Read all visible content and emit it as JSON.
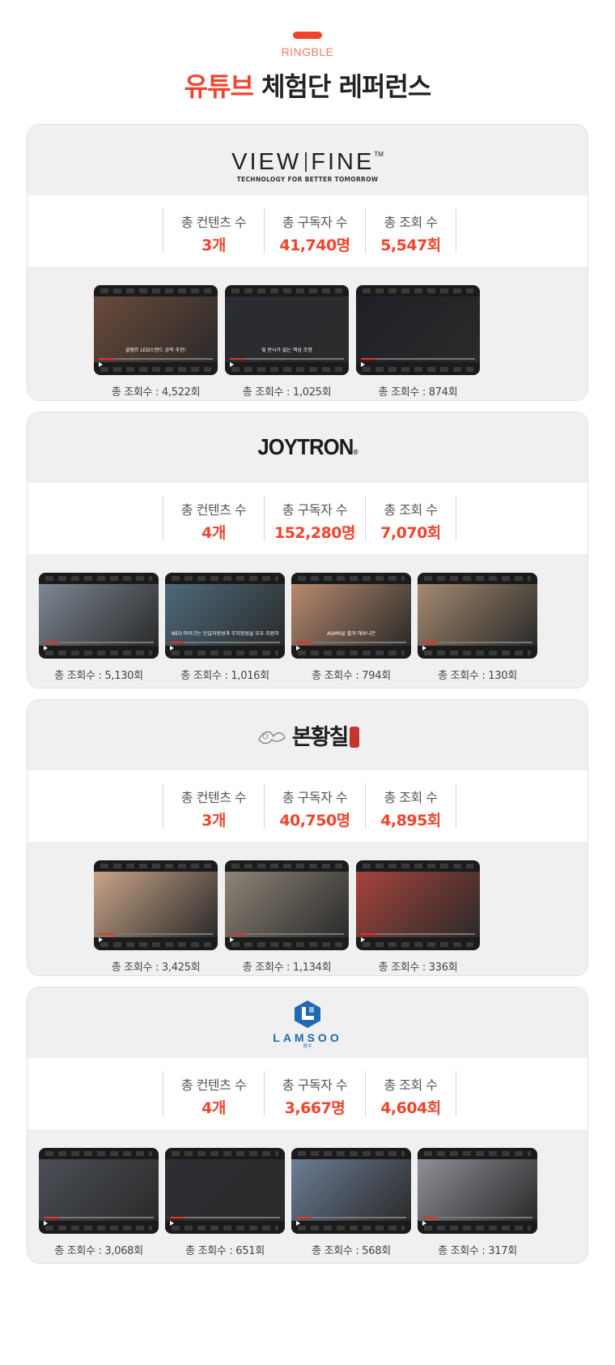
{
  "header": {
    "brand": "RINGBLE",
    "title_accent": "유튜브",
    "title_rest": " 체험단 레퍼런스"
  },
  "labels": {
    "contents": "총 컨텐츠 수",
    "subscribers": "총 구독자 수",
    "views": "총 조회 수"
  },
  "cards": [
    {
      "brand_logo": "VIEW|FINE",
      "logo_word_left": "VIEW",
      "logo_word_right": "FINE",
      "logo_tm": "TM",
      "logo_tagline": "TECHNOLOGY FOR BETTER TOMORROW",
      "contents": "3개",
      "subscribers": "41,740명",
      "views": "5,547회",
      "videos": [
        {
          "views": "총 조회수 : 4,522회",
          "caption": "클램프 LED스탠드 강력 추천!",
          "scene": "#6a4a3a"
        },
        {
          "views": "총 조회수 : 1,025회",
          "caption": "빛 반사가 없는 책상 조명",
          "scene": "#2a2d33"
        },
        {
          "views": "총 조회수 : 874회",
          "caption": "",
          "scene": "#1e2026"
        }
      ]
    },
    {
      "brand_logo": "JOYTRON",
      "logo_word": "JOYTRON",
      "logo_reg": "®",
      "contents": "4개",
      "subscribers": "152,280명",
      "views": "7,070회",
      "videos": [
        {
          "views": "총 조회수 : 5,130회",
          "caption": "",
          "scene": "#7d8793"
        },
        {
          "views": "총 조회수 : 1,016회",
          "caption": "NEO 마이크는 단일지향성과 무지향성을 모두 지원하기 때문에",
          "scene": "#4d6a7a"
        },
        {
          "views": "총 조회수 : 794회",
          "caption": "ASMR을 즐겨 해보니깐",
          "scene": "#b88a6c"
        },
        {
          "views": "총 조회수 : 130회",
          "caption": "",
          "scene": "#a58a70"
        }
      ]
    },
    {
      "brand_logo": "본황칠",
      "logo_word": "본황칠",
      "contents": "3개",
      "subscribers": "40,750명",
      "views": "4,895회",
      "videos": [
        {
          "views": "총 조회수 : 3,425회",
          "caption": "",
          "scene": "#c9a487"
        },
        {
          "views": "총 조회수 : 1,134회",
          "caption": "",
          "scene": "#8d8577"
        },
        {
          "views": "총 조회수 : 336회",
          "caption": "",
          "scene": "#a5433b"
        }
      ]
    },
    {
      "brand_logo": "LAMSOO",
      "logo_word": "LAMSOO",
      "logo_sub": "람수",
      "contents": "4개",
      "subscribers": "3,667명",
      "views": "4,604회",
      "videos": [
        {
          "views": "총 조회수 : 3,068회",
          "caption": "",
          "scene": "#4b4f55"
        },
        {
          "views": "총 조회수 : 651회",
          "caption": "",
          "scene": "#2d2f34"
        },
        {
          "views": "총 조회수 : 568회",
          "caption": "",
          "scene": "#6c7d95"
        },
        {
          "views": "총 조회수 : 317회",
          "caption": "",
          "scene": "#8e9097"
        }
      ]
    }
  ]
}
